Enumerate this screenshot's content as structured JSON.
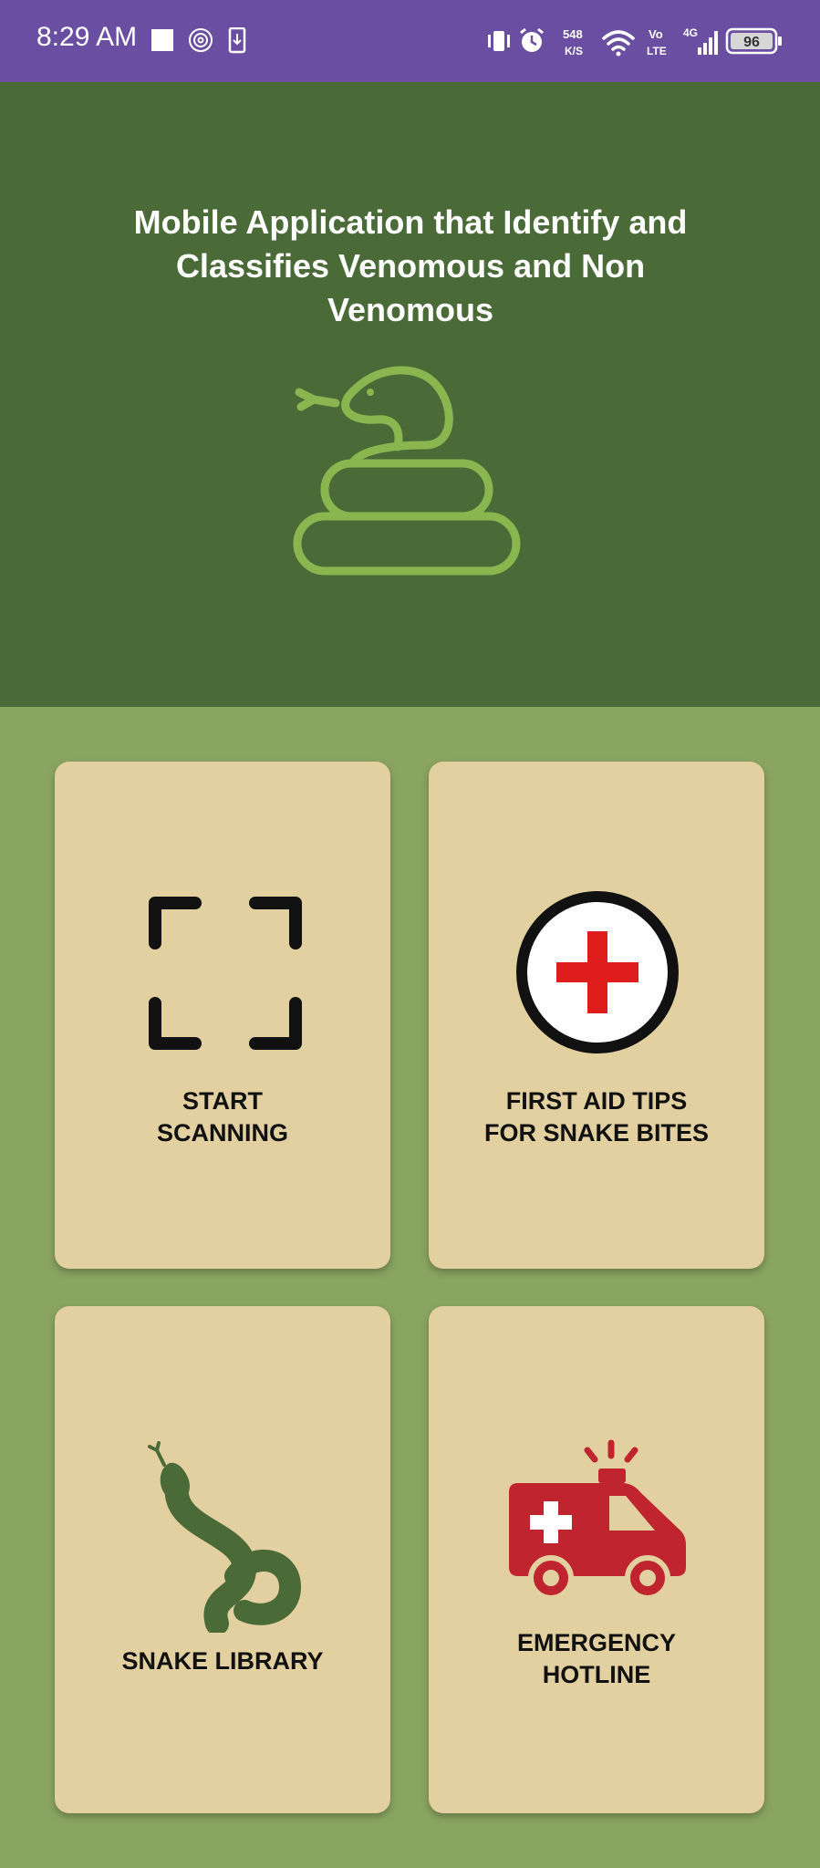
{
  "status_bar": {
    "time": "8:29 AM",
    "net_speed_top": "548",
    "net_speed_bottom": "K/S",
    "volte_top": "Vo",
    "volte_bottom": "LTE",
    "network": "4G",
    "battery": "96"
  },
  "header": {
    "title_lines": [
      "Mobile Application that Identify and",
      "Classifies Venomous and Non",
      "Venomous"
    ],
    "logo_icon": "coiled-snake-icon"
  },
  "cards": [
    {
      "label_lines": [
        "START",
        "SCANNING"
      ],
      "icon": "scan-frame-icon"
    },
    {
      "label_lines": [
        "FIRST AID TIPS",
        "FOR SNAKE BITES"
      ],
      "icon": "first-aid-cross-icon"
    },
    {
      "label_lines": [
        "SNAKE LIBRARY"
      ],
      "icon": "snake-icon"
    },
    {
      "label_lines": [
        "EMERGENCY",
        "HOTLINE"
      ],
      "icon": "ambulance-icon"
    }
  ],
  "colors": {
    "status_bar": "#6a4ea1",
    "header_bg": "#4a6b38",
    "page_bg": "#8aa461",
    "card_bg": "#e3d0a0",
    "logo_green": "#8ab650",
    "snake_green": "#4a6b38",
    "cross_red": "#e01d1d",
    "ambulance_red": "#c0242f"
  }
}
